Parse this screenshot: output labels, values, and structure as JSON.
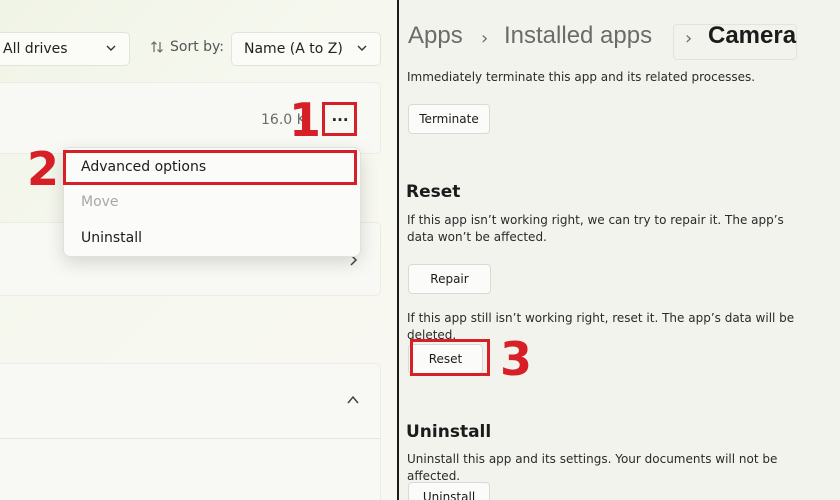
{
  "left": {
    "filter_drives": "All drives",
    "sort_label": "Sort by:",
    "sort_value": "Name (A to Z)",
    "app_size": "16.0 K",
    "more_button": "···",
    "menu": {
      "advanced": "Advanced options",
      "move": "Move",
      "uninstall": "Uninstall"
    }
  },
  "right": {
    "breadcrumb": [
      "Apps",
      "Installed apps",
      "Camera"
    ],
    "terminate_desc": "Immediately terminate this app and its related processes.",
    "terminate_button": "Terminate",
    "reset_heading": "Reset",
    "repair_desc": "If this app isn’t working right, we can try to repair it. The app’s data won’t be affected.",
    "repair_button": "Repair",
    "reset_desc": "If this app still isn’t working right, reset it. The app’s data will be deleted.",
    "reset_button": "Reset",
    "uninstall_heading": "Uninstall",
    "uninstall_desc": "Uninstall this app and its settings. Your documents will not be affected.",
    "uninstall_button": "Uninstall"
  },
  "annotations": {
    "step1": "1",
    "step2": "2",
    "step3": "3",
    "color": "#d61f26"
  }
}
